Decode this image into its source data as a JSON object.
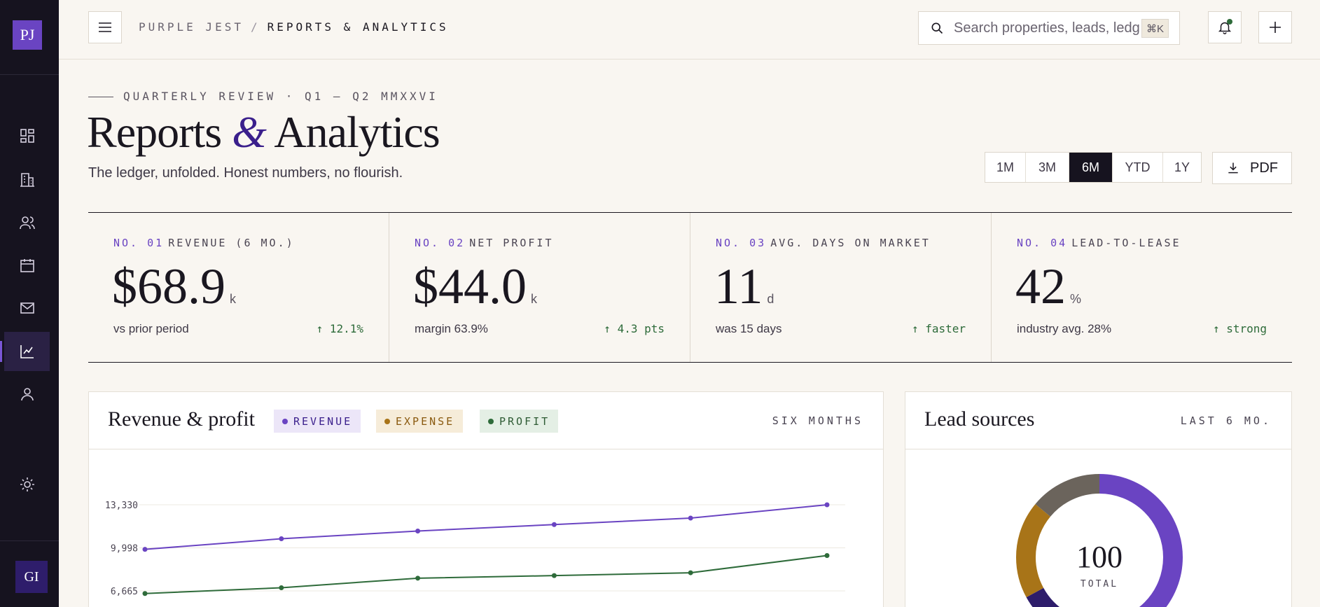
{
  "brand": {
    "logo": "PJ",
    "user_initials": "GI"
  },
  "breadcrumb": {
    "org": "PURPLE JEST",
    "sep": "/",
    "current": "REPORTS & ANALYTICS"
  },
  "search": {
    "placeholder": "Search properties, leads, ledgers…",
    "value": "",
    "shortcut": "⌘K"
  },
  "sidebar": {
    "items": [
      {
        "name": "dashboard",
        "icon": "grid-icon",
        "active": false
      },
      {
        "name": "properties",
        "icon": "building-icon",
        "active": false
      },
      {
        "name": "leads",
        "icon": "users-icon",
        "active": false
      },
      {
        "name": "calendar",
        "icon": "calendar-icon",
        "active": false
      },
      {
        "name": "messages",
        "icon": "mail-icon",
        "active": false
      },
      {
        "name": "reports",
        "icon": "chart-line-icon",
        "active": true
      },
      {
        "name": "profile",
        "icon": "user-icon",
        "active": false
      }
    ],
    "settings_icon": "sun-gear-icon"
  },
  "header": {
    "eyebrow": "QUARTERLY REVIEW · Q1 – Q2 MMXXVI",
    "title_a": "Reports ",
    "title_amp": "&",
    "title_b": " Analytics",
    "subtitle": "The ledger, unfolded. Honest numbers, no flourish."
  },
  "range": {
    "options": [
      "1M",
      "3M",
      "6M",
      "YTD",
      "1Y"
    ],
    "selected": "6M"
  },
  "export": {
    "label": "PDF",
    "icon": "download-icon"
  },
  "kpis": [
    {
      "num": "NO. 01",
      "label": "REVENUE (6 MO.)",
      "value": "$68.9",
      "unit": "k",
      "note": "vs prior period",
      "delta": "↑ 12.1%"
    },
    {
      "num": "NO. 02",
      "label": "NET PROFIT",
      "value": "$44.0",
      "unit": "k",
      "note": "margin 63.9%",
      "delta": "↑ 4.3 pts"
    },
    {
      "num": "NO. 03",
      "label": "AVG. DAYS ON MARKET",
      "value": "11",
      "unit": "d",
      "note": "was 15 days",
      "delta": "↑ faster"
    },
    {
      "num": "NO. 04",
      "label": "LEAD-TO-LEASE",
      "value": "42",
      "unit": "%",
      "note": "industry avg. 28%",
      "delta": "↑ strong"
    }
  ],
  "revenue_card": {
    "title": "Revenue & profit",
    "period": "SIX MONTHS",
    "legend": [
      {
        "label": "REVENUE",
        "color": "#6a44c2",
        "bg": "#ece6f8",
        "text": "#3a1f8c"
      },
      {
        "label": "EXPENSE",
        "color": "#a87418",
        "bg": "#f6ecd9",
        "text": "#8a5a10"
      },
      {
        "label": "PROFIT",
        "color": "#2e6b3a",
        "bg": "#e4efe5",
        "text": "#2e5b34"
      }
    ]
  },
  "leads_card": {
    "title": "Lead sources",
    "period": "LAST 6 MO.",
    "center_value": "100",
    "center_label": "TOTAL"
  },
  "chart_data": [
    {
      "type": "line",
      "title": "Revenue & profit",
      "x": [
        1,
        2,
        3,
        4,
        5,
        6
      ],
      "yticks": [
        "13,330",
        "9,998",
        "6,665"
      ],
      "ytick_values": [
        13330,
        9998,
        6665
      ],
      "ylim": [
        6665,
        13330
      ],
      "grid": true,
      "series": [
        {
          "name": "REVENUE",
          "color": "#6a44c2",
          "values": [
            9880,
            10700,
            11300,
            11800,
            12300,
            13330
          ]
        },
        {
          "name": "PROFIT",
          "color": "#2e6b3a",
          "values": [
            6460,
            6910,
            7650,
            7850,
            8070,
            9400
          ]
        }
      ]
    },
    {
      "type": "pie",
      "title": "Lead sources",
      "total": 100,
      "slices": [
        {
          "value": 50,
          "color": "#6a44c2"
        },
        {
          "value": 17,
          "color": "#2e1d6b"
        },
        {
          "value": 19,
          "color": "#a87418"
        },
        {
          "value": 14,
          "color": "#6b645c"
        }
      ]
    }
  ]
}
